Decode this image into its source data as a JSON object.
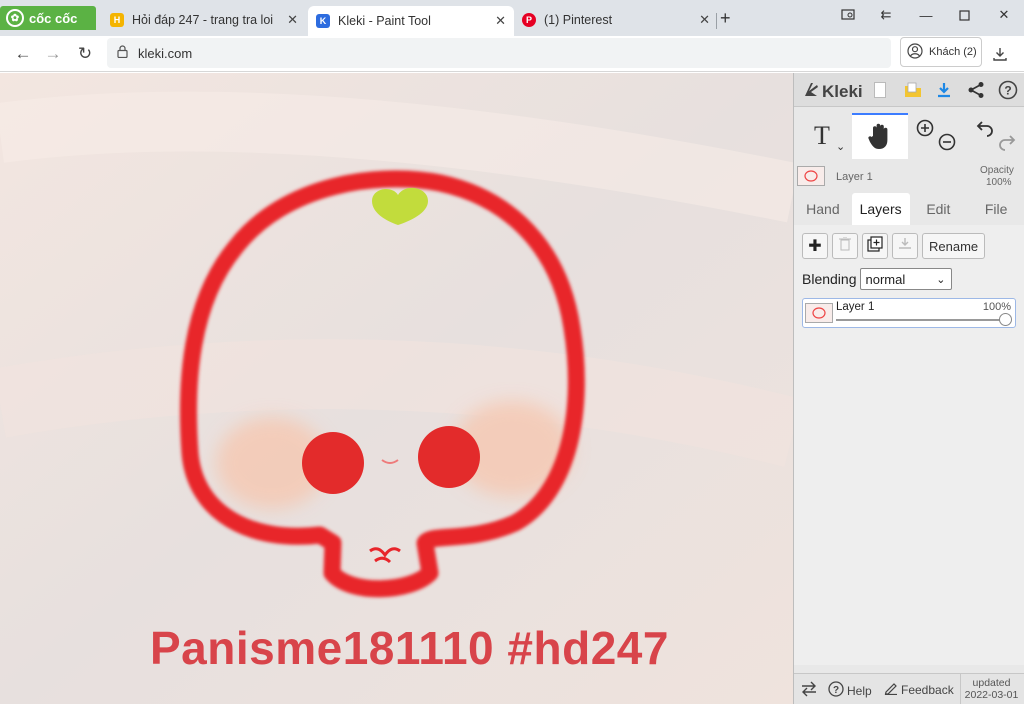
{
  "browser": {
    "brand": "cốc cốc",
    "tabs": [
      {
        "title": "Hỏi đáp 247 - trang tra loi",
        "favicon_color": "#f4b400"
      },
      {
        "title": "Kleki - Paint Tool",
        "favicon_color": "#2d6cdf"
      },
      {
        "title": "(1) Pinterest",
        "favicon_color": "#e60023"
      }
    ],
    "url": "kleki.com",
    "profile_label": "Khách (2)"
  },
  "canvas": {
    "watermark": "Panisme181110 #hd247",
    "stroke_color": "#e8252b",
    "leaf_color": "#c2dc3c",
    "blush_color": "#f5c9b4"
  },
  "kleki": {
    "logo": "Kleki",
    "layer_preview": {
      "name": "Layer 1",
      "opacity_label": "Opacity",
      "opacity_value": "100%"
    },
    "tabs": [
      "Hand",
      "Layers",
      "Edit",
      "File"
    ],
    "active_tab": "Layers",
    "rename_label": "Rename",
    "blending_label": "Blending",
    "blending_value": "normal",
    "layers": [
      {
        "name": "Layer 1",
        "opacity": "100%"
      }
    ],
    "footer": {
      "help": "Help",
      "feedback": "Feedback",
      "updated_label": "updated",
      "updated_date": "2022-03-01"
    }
  }
}
